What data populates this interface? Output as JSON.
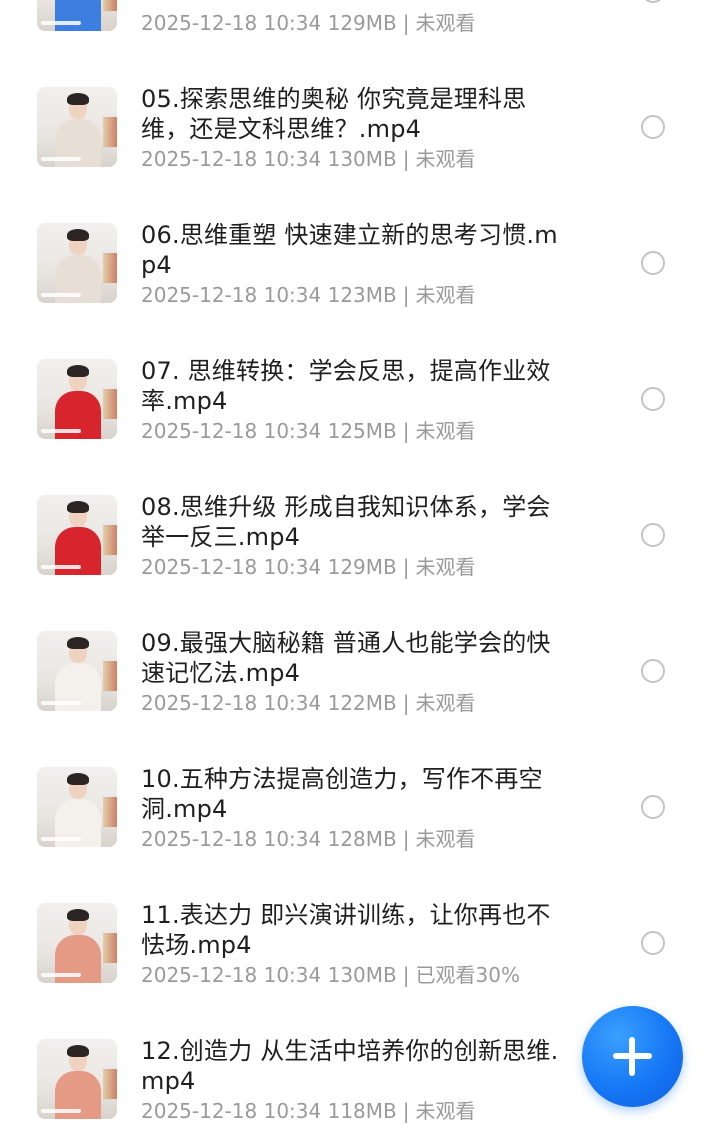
{
  "items": [
    {
      "title": "",
      "title_tail": "",
      "date": "2025-12-18 10:34",
      "size": "129MB",
      "status": "未观看",
      "shirt": "#3d7fe0"
    },
    {
      "title": "05.探索思维的奥秘 你究竟是理科思维，还是文科思维？.mp4",
      "date": "2025-12-18 10:34",
      "size": "130MB",
      "status": "未观看",
      "shirt": "#e7dfd6"
    },
    {
      "title": "06.思维重塑 快速建立新的思考习惯.mp4",
      "date": "2025-12-18 10:34",
      "size": "123MB",
      "status": "未观看",
      "shirt": "#e7dfd6"
    },
    {
      "title": "07. 思维转换：学会反思，提高作业效率.mp4",
      "date": "2025-12-18 10:34",
      "size": "125MB",
      "status": "未观看",
      "shirt": "#d8242d"
    },
    {
      "title": "08.思维升级 形成自我知识体系，学会举一反三.mp4",
      "date": "2025-12-18 10:34",
      "size": "129MB",
      "status": "未观看",
      "shirt": "#d8242d"
    },
    {
      "title": "09.最强大脑秘籍 普通人也能学会的快速记忆法.mp4",
      "date": "2025-12-18 10:34",
      "size": "122MB",
      "status": "未观看",
      "shirt": "#f4f1ec"
    },
    {
      "title": "10.五种方法提高创造力，写作不再空洞.mp4",
      "date": "2025-12-18 10:34",
      "size": "128MB",
      "status": "未观看",
      "shirt": "#f4f1ec"
    },
    {
      "title": "11.表达力 即兴演讲训练，让你再也不怯场.mp4",
      "date": "2025-12-18 10:34",
      "size": "130MB",
      "status": "已观看30%",
      "shirt": "#e59a86"
    },
    {
      "title": "12.创造力 从生活中培养你的创新思维.mp4",
      "date": "2025-12-18 10:34",
      "size": "118MB",
      "status": "未观看",
      "shirt": "#e59a86"
    }
  ],
  "separator": "|",
  "colors": {
    "accent": "#1677f5",
    "meta": "#9a9a9a",
    "title": "#1f1f1f"
  },
  "icons": {
    "fab": "plus-icon",
    "select": "radio-circle-icon"
  }
}
